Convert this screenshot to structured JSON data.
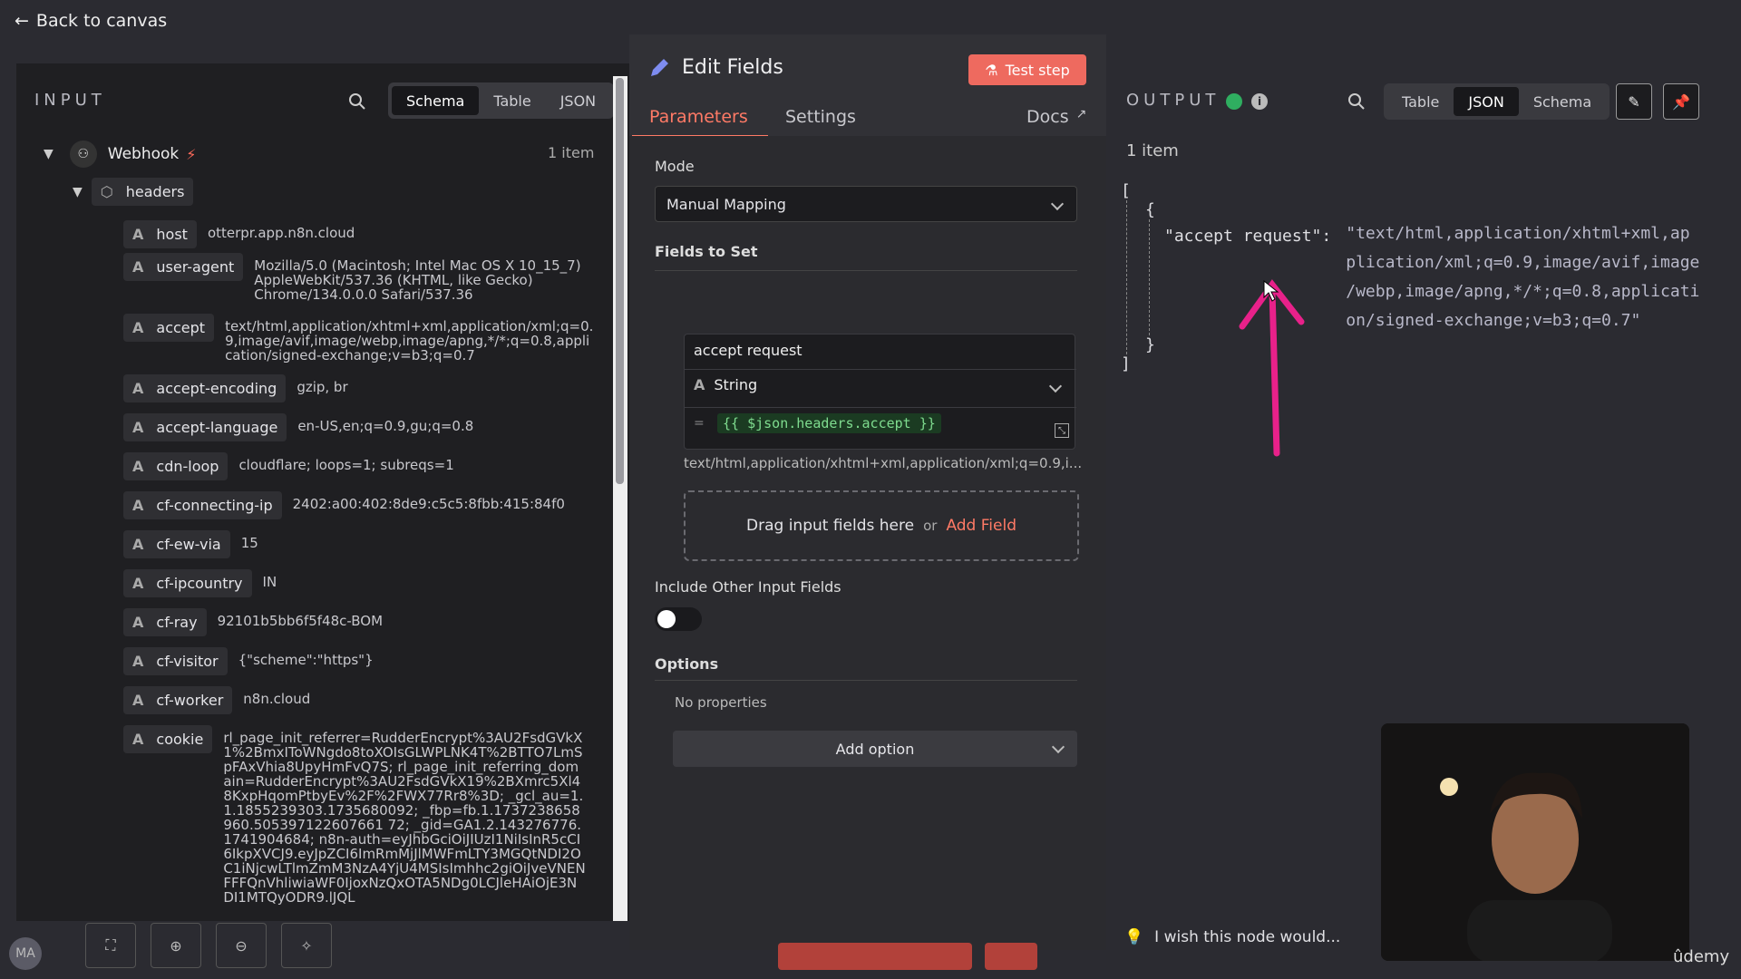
{
  "nav": {
    "back_label": "Back to canvas"
  },
  "input": {
    "title": "INPUT",
    "tabs": [
      "Schema",
      "Table",
      "JSON"
    ],
    "active_tab": "Schema",
    "node": {
      "name": "Webhook",
      "count": "1 item"
    },
    "group": "headers",
    "type_letter": "A",
    "fields": [
      {
        "key": "host",
        "value": "otterpr.app.n8n.cloud"
      },
      {
        "key": "user-agent",
        "value": "Mozilla/5.0 (Macintosh; Intel Mac OS X 10_15_7) AppleWebKit/537.36 (KHTML, like Gecko) Chrome/134.0.0.0 Safari/537.36"
      },
      {
        "key": "accept",
        "value": "text/html,application/xhtml+xml,application/xml;q=0.9,image/avif,image/webp,image/apng,*/*;q=0.8,application/signed-exchange;v=b3;q=0.7"
      },
      {
        "key": "accept-encoding",
        "value": "gzip, br"
      },
      {
        "key": "accept-language",
        "value": "en-US,en;q=0.9,gu;q=0.8"
      },
      {
        "key": "cdn-loop",
        "value": "cloudflare; loops=1; subreqs=1"
      },
      {
        "key": "cf-connecting-ip",
        "value": "2402:a00:402:8de9:c5c5:8fbb:415:84f0"
      },
      {
        "key": "cf-ew-via",
        "value": "15"
      },
      {
        "key": "cf-ipcountry",
        "value": "IN"
      },
      {
        "key": "cf-ray",
        "value": "92101b5bb6f5f48c-BOM"
      },
      {
        "key": "cf-visitor",
        "value": "{\"scheme\":\"https\"}"
      },
      {
        "key": "cf-worker",
        "value": "n8n.cloud"
      },
      {
        "key": "cookie",
        "value": "rl_page_init_referrer=RudderEncrypt%3AU2FsdGVkX1%2BmxIToWNgdo8toXOIsGLWPLNK4T%2BTTO7LmSpFAxVhia8UpyHmFvQ7S; rl_page_init_referring_domain=RudderEncrypt%3AU2FsdGVkX19%2BXmrc5Xl48KxpHqomPtbyEv%2F%2FWX77Rr8%3D; _gcl_au=1.1.1855239303.1735680092; _fbp=fb.1.1737238658960.505397122607661 72; _gid=GA1.2.143276776.1741904684; n8n-auth=eyJhbGciOiJIUzI1NiIsInR5cCI6IkpXVCJ9.eyJpZCI6ImRmMjJlMWFmLTY3MGQtNDI2OC1iNjcwLTlmZmM3NzA4YjU4MSIsImhhc2giOiJveVNENFFFQnVhliwiaWF0IjoxNzQxOTA5NDg0LCJleHAiOjE3NDI1MTQyODR9.lJQL"
      }
    ]
  },
  "editor": {
    "title": "Edit Fields",
    "test_button": "Test step",
    "tabs": {
      "parameters": "Parameters",
      "settings": "Settings",
      "docs": "Docs"
    },
    "mode_label": "Mode",
    "mode_value": "Manual Mapping",
    "fields_label": "Fields to Set",
    "field": {
      "name": "accept request",
      "type": "String",
      "expression": "{{ $json.headers.accept }}",
      "preview": "text/html,application/xhtml+xml,application/xml;q=0.9,i..."
    },
    "dropzone_text": "Drag input fields here",
    "dropzone_or": "or",
    "add_field": "Add Field",
    "include_label": "Include Other Input Fields",
    "options_label": "Options",
    "no_properties": "No properties",
    "add_option": "Add option"
  },
  "output": {
    "title": "OUTPUT",
    "tabs": [
      "Table",
      "JSON",
      "Schema"
    ],
    "active_tab": "JSON",
    "count": "1 item",
    "json_key": "\"accept request\":",
    "json_value_lines": [
      "\"text/html,application/xhtml+xml,ap",
      "plication/xml;q=0.9,image/avif,image",
      "/webp,image/apng,*/*;q=0.8,applicati",
      "on/signed-exchange;v=b3;q=0.7\""
    ]
  },
  "bottom": {
    "hint": "I wish this node would...",
    "avatar": "MA",
    "watermark": "ûdemy"
  },
  "colors": {
    "accent": "#ff7a66",
    "test_button": "#ee6a5f",
    "success": "#2fae60",
    "annotation": "#e8218a"
  }
}
